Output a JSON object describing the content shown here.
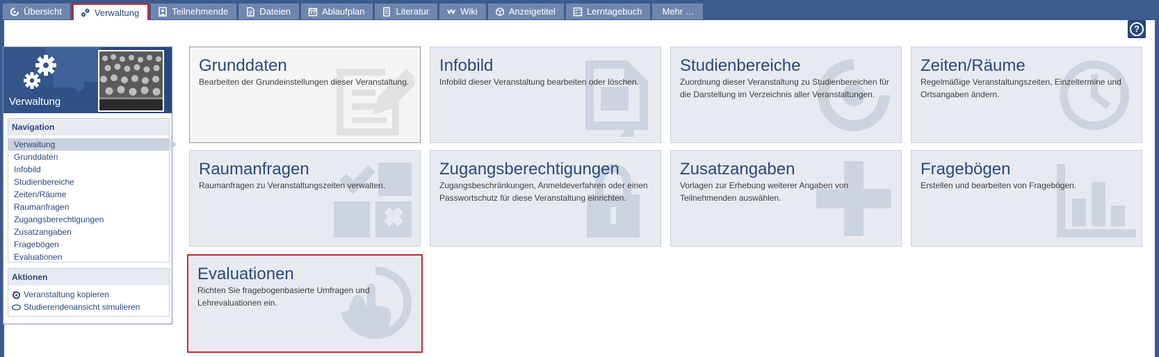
{
  "tabs": [
    {
      "label": "Übersicht",
      "icon": "overview-icon",
      "active": false
    },
    {
      "label": "Verwaltung",
      "icon": "gears-icon",
      "active": true
    },
    {
      "label": "Teilnehmende",
      "icon": "persons-icon",
      "active": false
    },
    {
      "label": "Dateien",
      "icon": "files-icon",
      "active": false
    },
    {
      "label": "Ablaufplan",
      "icon": "schedule-icon",
      "active": false
    },
    {
      "label": "Literatur",
      "icon": "literature-icon",
      "active": false
    },
    {
      "label": "Wiki",
      "icon": "wiki-icon",
      "active": false
    },
    {
      "label": "Anzeigetitel",
      "icon": "board-icon",
      "active": false
    },
    {
      "label": "Lerntagebuch",
      "icon": "diary-icon",
      "active": false
    },
    {
      "label": "Mehr …",
      "icon": "",
      "active": false
    }
  ],
  "help": {
    "label": "?"
  },
  "sidebar": {
    "title": "Verwaltung",
    "navigation_header": "Navigation",
    "navigation": [
      "Verwaltung",
      "Grunddaten",
      "Infobild",
      "Studienbereiche",
      "Zeiten/Räume",
      "Raumanfragen",
      "Zugangsberechtigungen",
      "Zusatzangaben",
      "Fragebögen",
      "Evaluationen"
    ],
    "actions_header": "Aktionen",
    "actions": [
      {
        "label": "Veranstaltung kopieren",
        "icon": "copy-seminar-icon"
      },
      {
        "label": "Studierendenansicht simulieren",
        "icon": "visibility-icon"
      }
    ]
  },
  "tiles": [
    {
      "title": "Grunddaten",
      "desc": "Bearbeiten der Grundeinstellungen dieser Veranstaltung.",
      "icon": "edit-icon"
    },
    {
      "title": "Infobild",
      "desc": "Infobild dieser Veranstaltung bearbeiten oder löschen.",
      "icon": "file-pic-icon"
    },
    {
      "title": "Studienbereiche",
      "desc": "Zuordnung dieser Veranstaltung zu Studienbereichen für die Darstellung im Verzeichnis aller Veranstaltungen.",
      "icon": "module-icon"
    },
    {
      "title": "Zeiten/Räume",
      "desc": "Regelmäßige Veranstaltungszeiten, Einzeltermine und Ortsangaben ändern.",
      "icon": "clock-icon"
    },
    {
      "title": "Raumanfragen",
      "desc": "Raumanfragen zu Veranstaltungszeiten verwalten.",
      "icon": "room-request-icon"
    },
    {
      "title": "Zugangsberechtigungen",
      "desc": "Zugangsbeschränkungen, Anmeldeverfahren oder einen Passwortschutz für diese Veranstaltung einrichten.",
      "icon": "lock-icon"
    },
    {
      "title": "Zusatzangaben",
      "desc": "Vorlagen zur Erhebung weiterer Angaben von Teilnehmenden auswählen.",
      "icon": "plus-icon"
    },
    {
      "title": "Fragebögen",
      "desc": "Erstellen und bearbeiten von Fragebögen.",
      "icon": "bar-chart-icon"
    },
    {
      "title": "Evaluationen",
      "desc": "Richten Sie fragebogenbasierte Umfragen und Lehrevaluationen ein.",
      "icon": "evaluation-icon"
    }
  ],
  "colors": {
    "brand": "#28497c",
    "tab_bg": "#6f87ad",
    "tile_bg": "#e7ebf1",
    "highlight": "#d2232a"
  }
}
